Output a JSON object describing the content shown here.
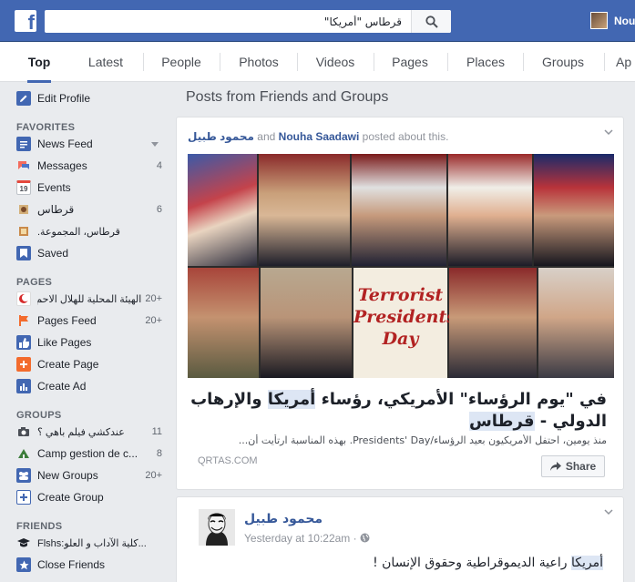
{
  "search": {
    "value": "قرطاس \"أمريكا\"",
    "placeholder": ""
  },
  "user": {
    "name": "Nouh"
  },
  "tabs": [
    "Top",
    "Latest",
    "People",
    "Photos",
    "Videos",
    "Pages",
    "Places",
    "Groups",
    "Ap"
  ],
  "sidebar": {
    "edit_profile": "Edit Profile",
    "favorites_head": "FAVORITES",
    "favorites": [
      {
        "label": "News Feed",
        "count": ""
      },
      {
        "label": "Messages",
        "count": "4"
      },
      {
        "label": "Events",
        "count": ""
      },
      {
        "label": "قرطاس",
        "count": "6"
      },
      {
        "label": "قرطاس، المجموعة.",
        "count": ""
      },
      {
        "label": "Saved",
        "count": ""
      }
    ],
    "events_date": "19",
    "pages_head": "PAGES",
    "pages": [
      {
        "label": "الهيئة المحلية للهلال الاحم",
        "count": "20+"
      },
      {
        "label": "Pages Feed",
        "count": "20+"
      },
      {
        "label": "Like Pages",
        "count": ""
      },
      {
        "label": "Create Page",
        "count": ""
      },
      {
        "label": "Create Ad",
        "count": ""
      }
    ],
    "groups_head": "GROUPS",
    "groups": [
      {
        "label": "عندكشي فيلم باهي ؟",
        "count": "11"
      },
      {
        "label": "Camp gestion de c...",
        "count": "8"
      },
      {
        "label": "New Groups",
        "count": "20+"
      },
      {
        "label": "Create Group",
        "count": ""
      }
    ],
    "friends_head": "FRIENDS",
    "friends": [
      {
        "label": "Flshs:كلية الآداب و العلو...",
        "count": ""
      },
      {
        "label": "Close Friends",
        "count": ""
      }
    ]
  },
  "main": {
    "title": "Posts from Friends and Groups",
    "post1": {
      "author1": "محمود طبيل",
      "connector": " and ",
      "author2": "Nouha Saadawi",
      "action": " posted about this.",
      "image_text": "Terrorist Presidents' Day",
      "link_title_a": "في \"يوم الرؤساء\" الأمريكي، رؤساء ",
      "link_title_hl": "أمريكا",
      "link_title_b": " والإرهاب الدولي - ",
      "link_title_hl2": "قرطاس",
      "link_desc": "منذ يومين، احتفل الأمريكيون بعيد الرؤساء/Presidents' Day. بهذه المناسبة ارتأيت أن...",
      "domain": "QRTAS.COM",
      "share": "Share"
    },
    "post2": {
      "author": "محمود طبيل",
      "time": "Yesterday at 10:22am · ",
      "body_hl": "أمريكا",
      "body": " راعية الديموقراطية وحقوق الإنسان !"
    }
  },
  "colors": {
    "brand": "#4267b2",
    "link": "#365899",
    "highlight": "#dde6f4"
  }
}
